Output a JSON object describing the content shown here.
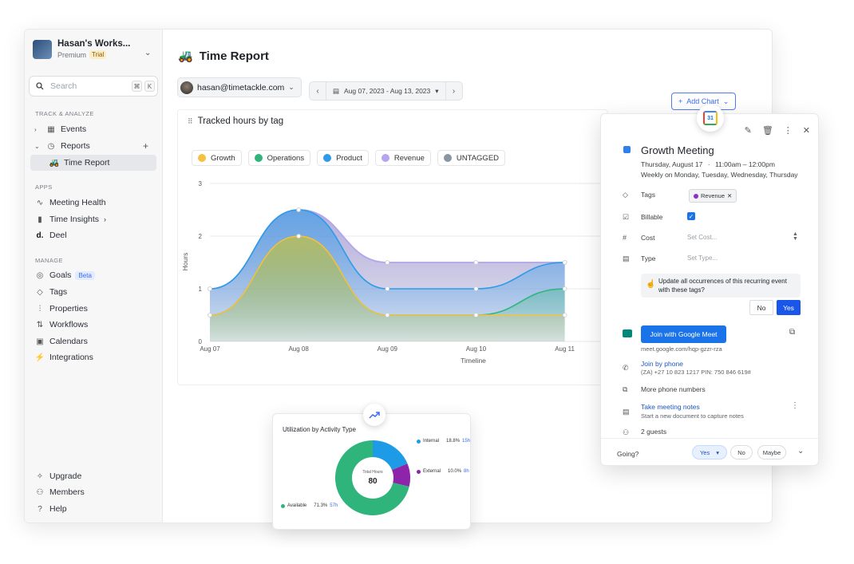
{
  "workspace": {
    "name": "Hasan's Works...",
    "plan": "Premium",
    "badge": "Trial"
  },
  "search": {
    "placeholder": "Search",
    "key1": "⌘",
    "key2": "K"
  },
  "sidebar": {
    "track_heading": "TRACK & ANALYZE",
    "events": "Events",
    "reports": "Reports",
    "time_report": "Time Report",
    "apps_heading": "APPS",
    "meeting_health": "Meeting Health",
    "time_insights": "Time Insights",
    "deel": "Deel",
    "manage_heading": "MANAGE",
    "goals": "Goals",
    "goals_badge": "Beta",
    "tags": "Tags",
    "properties": "Properties",
    "workflows": "Workflows",
    "calendars": "Calendars",
    "integrations": "Integrations",
    "upgrade": "Upgrade",
    "members": "Members",
    "help": "Help"
  },
  "page": {
    "title": "Time Report",
    "user_email": "hasan@timetackle.com",
    "date_range": "Aug 07, 2023 - Aug 13, 2023",
    "add_chart": "Add Chart"
  },
  "chart_card": {
    "title": "Tracked hours by tag"
  },
  "chart_data": {
    "type": "area",
    "title": "Tracked hours by tag",
    "xlabel": "Timeline",
    "ylabel": "Hours",
    "categories": [
      "Aug 07",
      "Aug 08",
      "Aug 09",
      "Aug 10",
      "Aug 11"
    ],
    "yticks": [
      "0",
      "1",
      "2",
      "3"
    ],
    "ylim": [
      0,
      3
    ],
    "grid": true,
    "series": [
      {
        "name": "Growth",
        "color": "#f5c142",
        "values": [
          0.5,
          2.0,
          0.5,
          0.5,
          0.5
        ]
      },
      {
        "name": "Operations",
        "color": "#2fb57c",
        "values": [
          0.5,
          2.0,
          0.5,
          0.5,
          1.0
        ]
      },
      {
        "name": "Product",
        "color": "#2d9be8",
        "values": [
          1.0,
          2.5,
          1.0,
          1.0,
          1.5
        ]
      },
      {
        "name": "Revenue",
        "color": "#b6a5ee",
        "values": [
          1.0,
          2.5,
          1.5,
          1.5,
          1.5
        ]
      },
      {
        "name": "UNTAGGED",
        "color": "#8c96a3",
        "values": [
          1.0,
          2.5,
          1.5,
          1.5,
          1.5
        ]
      }
    ]
  },
  "event": {
    "title": "Growth Meeting",
    "date": "Thursday, August 17",
    "sep": "·",
    "time": "11:00am – 12:00pm",
    "recurrence": "Weekly on Monday, Tuesday, Wednesday, Thursday",
    "tags_label": "Tags",
    "tag_value": "Revenue",
    "billable_label": "Billable",
    "cost_label": "Cost",
    "cost_placeholder": "Set Cost...",
    "type_label": "Type",
    "type_placeholder": "Set Type...",
    "notice": "Update all occurrences of this recurring event with these tags?",
    "no": "No",
    "yes": "Yes",
    "join_meet": "Join with Google Meet",
    "meet_link": "meet.google.com/hqp-gzzr-rza",
    "join_phone": "Join by phone",
    "phone_detail": "(ZA) +27 10 823 1217 PIN: 750 846 619#",
    "more_phones": "More phone numbers",
    "take_notes": "Take meeting notes",
    "notes_sub": "Start a new document to capture notes",
    "guests": "2 guests",
    "going": "Going?",
    "rsvp_yes": "Yes",
    "rsvp_no": "No",
    "rsvp_maybe": "Maybe"
  },
  "donut": {
    "title": "Utilization by Activity Type",
    "center_label": "Total Hours",
    "center_value": "80",
    "segments": [
      {
        "name": "Internal",
        "pct": "18.8%",
        "hours": "15h",
        "value": 18.8,
        "color": "#1d9be6"
      },
      {
        "name": "External",
        "pct": "10.0%",
        "hours": "8h",
        "value": 10.0,
        "color": "#8e24aa"
      },
      {
        "name": "Available",
        "pct": "71.3%",
        "hours": "57h",
        "value": 71.3,
        "color": "#2fb57c"
      }
    ]
  }
}
